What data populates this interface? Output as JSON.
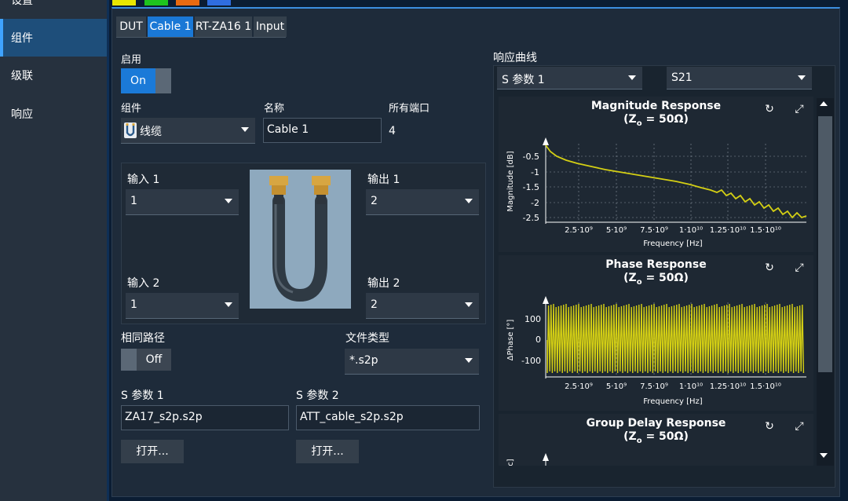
{
  "sidebar": {
    "items": [
      {
        "label": "设置"
      },
      {
        "label": "组件"
      },
      {
        "label": "级联"
      },
      {
        "label": "响应"
      }
    ]
  },
  "colors": {
    "accent": "#1b7ad8",
    "curve": "#d4cf14",
    "swatches": [
      "#e8e600",
      "#1ec41e",
      "#e86a10",
      "#2f6de0"
    ]
  },
  "tabs": [
    {
      "label": "DUT"
    },
    {
      "label": "Cable 1"
    },
    {
      "label": "RT-ZA16 1"
    },
    {
      "label": "Input"
    }
  ],
  "enable": {
    "label": "启用",
    "value": "On"
  },
  "component": {
    "label": "组件",
    "value": "线缆",
    "icon": "cable-icon"
  },
  "name": {
    "label": "名称",
    "value": "Cable 1"
  },
  "ports": {
    "label": "所有端口",
    "value": "4"
  },
  "input1": {
    "label": "输入 1",
    "value": "1"
  },
  "input2": {
    "label": "输入 2",
    "value": "1"
  },
  "output1": {
    "label": "输出 1",
    "value": "2"
  },
  "output2": {
    "label": "输出 2",
    "value": "2"
  },
  "same_path": {
    "label": "相同路径",
    "value": "Off"
  },
  "file_type": {
    "label": "文件类型",
    "value": "*.s2p"
  },
  "sparam1": {
    "label": "S 参数 1",
    "value": "ZA17_s2p.s2p",
    "button": "打开..."
  },
  "sparam2": {
    "label": "S 参数 2",
    "value": "ATT_cable_s2p.s2p",
    "button": "打开..."
  },
  "response": {
    "label": "响应曲线",
    "param_select": "S 参数 1",
    "sparam_select": "S21"
  },
  "plots": {
    "magnitude": {
      "title1": "Magnitude Response",
      "title2": "(Z",
      "title_sub": "o",
      "title3": " = 50Ω)",
      "ylabel": "Magnitude [dB]",
      "xlabel": "Frequency [Hz]",
      "yticks": [
        "-0.5",
        "-1",
        "-1.5",
        "-2",
        "-2.5"
      ],
      "xticks": [
        "2.5·10⁹",
        "5·10⁹",
        "7.5·10⁹",
        "1·10¹⁰",
        "1.25·10¹⁰",
        "1.5·10¹⁰"
      ]
    },
    "phase": {
      "title1": "Phase Response",
      "title2": "(Z",
      "title_sub": "o",
      "title3": " = 50Ω)",
      "ylabel": "ΔPhase [°]",
      "xlabel": "Frequency [Hz]",
      "yticks": [
        "100",
        "0",
        "-100"
      ],
      "xticks": [
        "2.5·10⁹",
        "5·10⁹",
        "7.5·10⁹",
        "1·10¹⁰",
        "1.25·10¹⁰",
        "1.5·10¹⁰"
      ]
    },
    "group_delay": {
      "title1": "Group Delay Response",
      "title2": "(Z",
      "title_sub": "o",
      "title3": " = 50Ω)",
      "ylabel_fragment": "c]"
    }
  }
}
